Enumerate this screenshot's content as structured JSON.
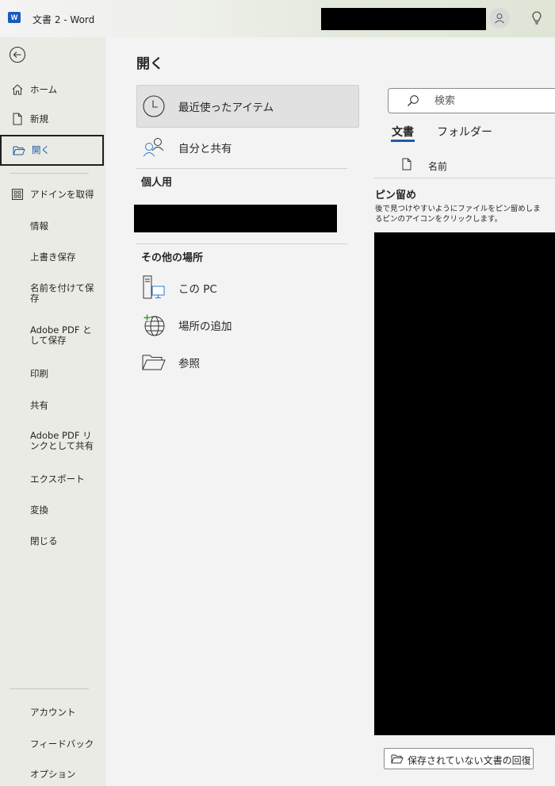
{
  "titlebar": {
    "app_title": "文書 2  -  Word",
    "logo_letter": "W"
  },
  "page": {
    "title": "開く"
  },
  "nav": {
    "items": [
      {
        "label": "ホーム",
        "icon": "home-icon"
      },
      {
        "label": "新規",
        "icon": "new-document-icon"
      },
      {
        "label": "開く",
        "icon": "folder-open-icon",
        "selected": true
      },
      {
        "label": "アドインを取得",
        "icon": "addins-icon"
      },
      {
        "label": "情報"
      },
      {
        "label": "上書き保存"
      },
      {
        "label": "名前を付けて保存"
      },
      {
        "label": "Adobe PDF として保存"
      },
      {
        "label": "印刷"
      },
      {
        "label": "共有"
      },
      {
        "label": "Adobe PDF リンクとして共有"
      },
      {
        "label": "エクスポート"
      },
      {
        "label": "変換"
      },
      {
        "label": "閉じる"
      }
    ],
    "bottom_items": [
      {
        "label": "アカウント"
      },
      {
        "label": "フィードバック"
      },
      {
        "label": "オプション"
      }
    ]
  },
  "locations": {
    "recent": "最近使ったアイテム",
    "shared": "自分と共有",
    "personal_header": "個人用",
    "other_header": "その他の場所",
    "this_pc": "この PC",
    "add_place": "場所の追加",
    "browse": "参照"
  },
  "right_pane": {
    "search_placeholder": "検索",
    "tabs": [
      "文書",
      "フォルダー"
    ],
    "active_tab": "文書",
    "column_name": "名前",
    "pinned_title": "ピン留め",
    "pinned_desc_line1": "後で見つけやすいようにファイルをピン留めしま",
    "pinned_desc_line2": "るピンのアイコンをクリックします。",
    "recover_button": "保存されていない文書の回復"
  },
  "colors": {
    "accent": "#185abd",
    "tab_underline": "#1f5aa8",
    "add_place_plus": "#3a9b3a",
    "pc_screen": "#2b7bd3"
  }
}
